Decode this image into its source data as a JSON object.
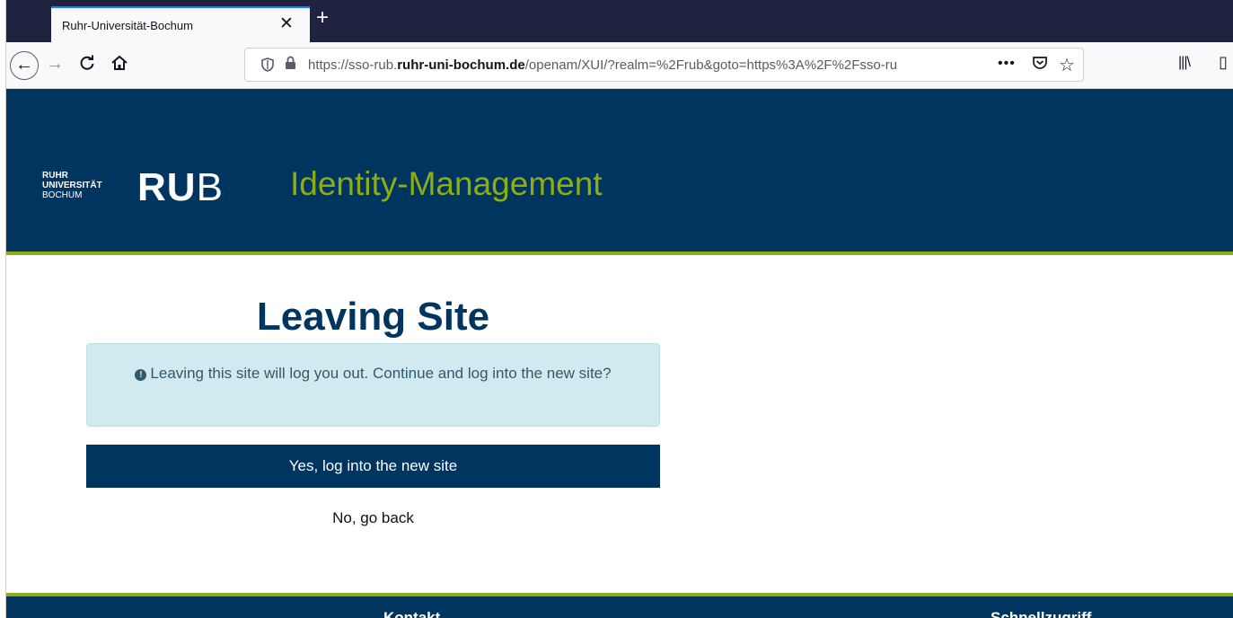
{
  "browser": {
    "tab_title": "Ruhr-Universität-Bochum",
    "tab_close": "✕",
    "new_tab": "+",
    "url_prefix": "https://sso-rub.",
    "url_domain": "ruhr-uni-bochum.de",
    "url_path": "/openam/XUI/?realm=%2Frub&goto=https%3A%2F%2Fsso-ru",
    "url_more": "•••",
    "icons": {
      "back": "←",
      "forward": "→",
      "reload": "C",
      "home": "⌂",
      "shield": "⛉",
      "lock": "🔒",
      "pocket": "⊽",
      "star": "☆",
      "library": "|||\\",
      "sidebar": "▯"
    }
  },
  "header": {
    "logo_line1": "RUHR",
    "logo_line2": "UNIVERSITÄT",
    "logo_line3": "BOCHUM",
    "logo_ru": "RU",
    "logo_b": "B",
    "title": "Identity-Management"
  },
  "main": {
    "title": "Leaving Site",
    "alert_text": "Leaving this site will log you out. Continue and log into the new site?",
    "alert_icon": "!",
    "yes_button": "Yes, log into the new site",
    "no_link": "No, go back"
  },
  "footer": {
    "heading_contact": "Kontakt",
    "heading_quick": "Schnellzugriff"
  },
  "colors": {
    "brand_blue": "#003560",
    "brand_green": "#8dae10",
    "alert_bg": "#d1eaf0"
  }
}
